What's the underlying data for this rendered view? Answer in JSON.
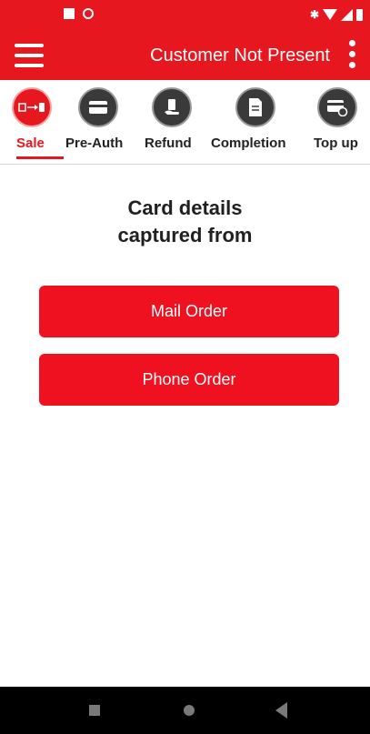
{
  "app_bar": {
    "title": "Customer Not Present"
  },
  "tabs": [
    {
      "label": "Sale",
      "icon": "sale-icon",
      "active": true
    },
    {
      "label": "Pre-Auth",
      "icon": "card-icon",
      "active": false
    },
    {
      "label": "Refund",
      "icon": "refund-icon",
      "active": false
    },
    {
      "label": "Completion",
      "icon": "document-icon",
      "active": false
    },
    {
      "label": "Top up",
      "icon": "topup-card-icon",
      "active": false
    }
  ],
  "main": {
    "heading_line1": "Card details",
    "heading_line2": "captured from",
    "mail_order_label": "Mail Order",
    "phone_order_label": "Phone Order"
  },
  "colors": {
    "accent": "#e7171f",
    "button": "#ef1020",
    "nav_bar": "#000000"
  }
}
